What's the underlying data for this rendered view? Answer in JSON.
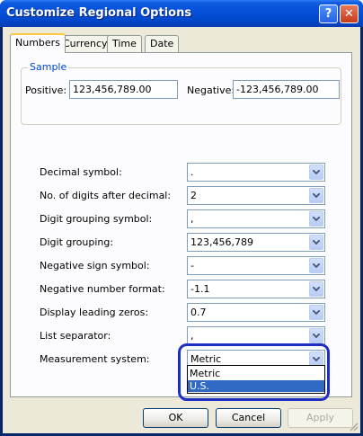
{
  "window": {
    "title": "Customize Regional Options",
    "help_glyph": "?",
    "close_glyph": "✕"
  },
  "tabs": [
    {
      "label": "Numbers",
      "active": true
    },
    {
      "label": "Currency",
      "active": false
    },
    {
      "label": "Time",
      "active": false
    },
    {
      "label": "Date",
      "active": false
    }
  ],
  "sample": {
    "legend": "Sample",
    "positive_label": "Positive:",
    "positive_value": "123,456,789.00",
    "negative_label": "Negative:",
    "negative_value": "-123,456,789.00"
  },
  "settings": [
    {
      "label": "Decimal symbol:",
      "value": "."
    },
    {
      "label": "No. of digits after decimal:",
      "value": "2"
    },
    {
      "label": "Digit grouping symbol:",
      "value": ","
    },
    {
      "label": "Digit grouping:",
      "value": "123,456,789"
    },
    {
      "label": "Negative sign symbol:",
      "value": "-"
    },
    {
      "label": "Negative number format:",
      "value": "-1.1"
    },
    {
      "label": "Display leading zeros:",
      "value": "0.7"
    },
    {
      "label": "List separator:",
      "value": ","
    },
    {
      "label": "Measurement system:",
      "value": "Metric"
    }
  ],
  "measurement_dropdown": {
    "options": [
      "Metric",
      "U.S."
    ],
    "highlighted": "U.S."
  },
  "buttons": {
    "ok": "OK",
    "cancel": "Cancel",
    "apply": "Apply"
  },
  "colors": {
    "title_bar": "#0550d8",
    "selection": "#316ac5",
    "annotation_circle": "#1c2fc2"
  }
}
